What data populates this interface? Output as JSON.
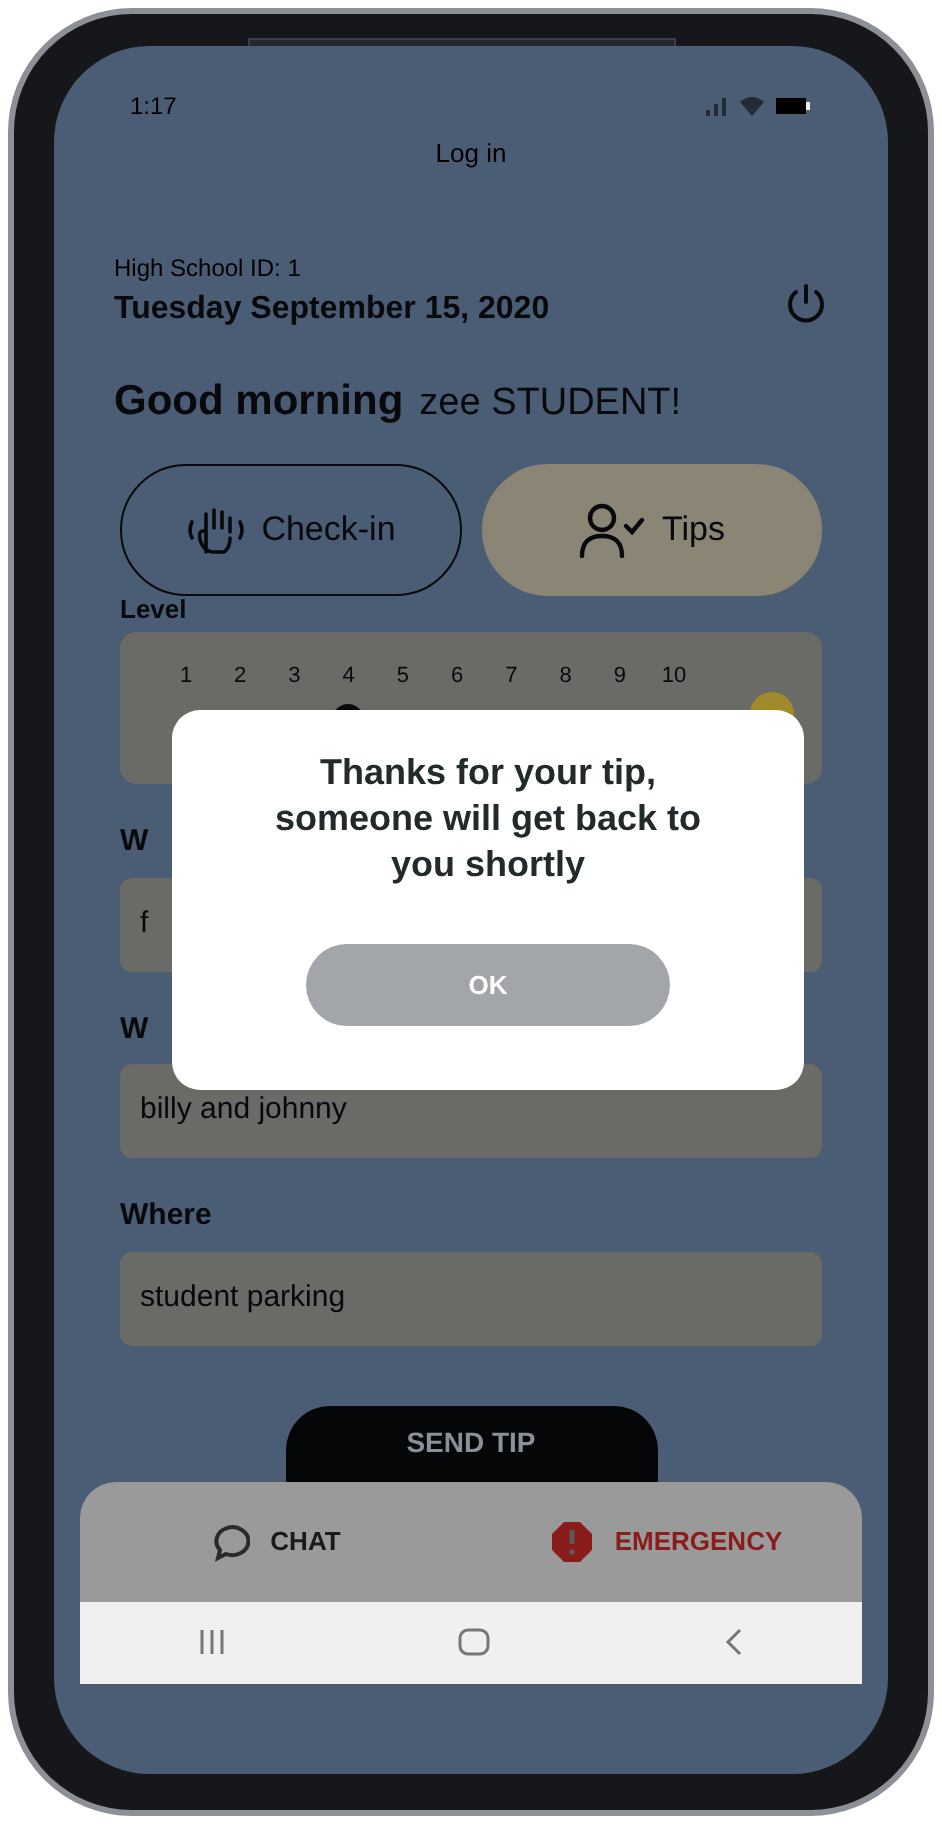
{
  "status_bar": {
    "time": "1:17"
  },
  "header": {
    "title": "Log in"
  },
  "school": "High School ID: 1",
  "date": "Tuesday September 15, 2020",
  "greeting": {
    "text": "Good morning",
    "name": "zee STUDENT!"
  },
  "mode_tabs": [
    {
      "label": "Check-in",
      "selected": false
    },
    {
      "label": "Tips",
      "selected": true
    }
  ],
  "level": {
    "label": "Level",
    "scale": [
      "1",
      "2",
      "3",
      "4",
      "5",
      "6",
      "7",
      "8",
      "9",
      "10"
    ],
    "level": 0.333
  },
  "fields": [
    {
      "label": "W",
      "value": "f"
    },
    {
      "label": "W",
      "value": "billy and johnny"
    },
    {
      "label": "Where",
      "value": "student parking"
    }
  ],
  "send_button": "SEND TIP",
  "bottom_tabs": [
    {
      "label": "CHAT",
      "kind": "chat"
    },
    {
      "label": "EMERGENCY",
      "kind": "emergency"
    }
  ],
  "dialog": {
    "message": "Thanks for your tip, someone will get back to you shortly",
    "button": "OK"
  }
}
